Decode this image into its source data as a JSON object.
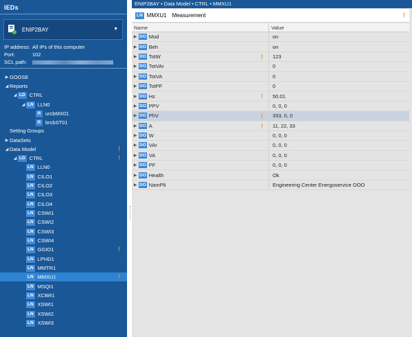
{
  "ieds_panel": {
    "title": "IEDs",
    "ied_name": "ENIP2BAY",
    "ip_label": "IP address:",
    "ip_value": "All IPs of this computer",
    "port_label": "Port:",
    "port_value": "102",
    "scl_label": "SCL path:"
  },
  "tree": [
    {
      "label": "GOOSE",
      "badge": "",
      "toggle": "▶",
      "warn": false
    },
    {
      "label": "Reports",
      "badge": "",
      "toggle": "◢",
      "warn": false
    },
    {
      "label": "CTRL",
      "badge": "LD",
      "toggle": "◢",
      "warn": false
    },
    {
      "label": "LLN0",
      "badge": "LN",
      "toggle": "◢",
      "warn": false
    },
    {
      "label": "urcbMX01",
      "badge": "R",
      "toggle": "",
      "warn": false
    },
    {
      "label": "brcbST01",
      "badge": "R",
      "toggle": "",
      "warn": false
    },
    {
      "label": "Setting Groups",
      "badge": "",
      "toggle": "",
      "warn": false
    },
    {
      "label": "DataSets",
      "badge": "",
      "toggle": "▶",
      "warn": false
    },
    {
      "label": "Data Model",
      "badge": "",
      "toggle": "◢",
      "warn": true
    },
    {
      "label": "CTRL",
      "badge": "LD",
      "toggle": "◢",
      "warn": true
    },
    {
      "label": "LLN0",
      "badge": "LN",
      "toggle": "",
      "warn": false
    },
    {
      "label": "CILO1",
      "badge": "LN",
      "toggle": "",
      "warn": false
    },
    {
      "label": "CILO2",
      "badge": "LN",
      "toggle": "",
      "warn": false
    },
    {
      "label": "CILO3",
      "badge": "LN",
      "toggle": "",
      "warn": false
    },
    {
      "label": "CILO4",
      "badge": "LN",
      "toggle": "",
      "warn": false
    },
    {
      "label": "CSWI1",
      "badge": "LN",
      "toggle": "",
      "warn": false
    },
    {
      "label": "CSWI2",
      "badge": "LN",
      "toggle": "",
      "warn": false
    },
    {
      "label": "CSWI3",
      "badge": "LN",
      "toggle": "",
      "warn": false
    },
    {
      "label": "CSWI4",
      "badge": "LN",
      "toggle": "",
      "warn": false
    },
    {
      "label": "GGIO1",
      "badge": "LN",
      "toggle": "",
      "warn": true
    },
    {
      "label": "LPHD1",
      "badge": "LN",
      "toggle": "",
      "warn": false
    },
    {
      "label": "MMTR1",
      "badge": "LN",
      "toggle": "",
      "warn": false
    },
    {
      "label": "MMXU1",
      "badge": "LN",
      "toggle": "",
      "warn": true,
      "selected": true
    },
    {
      "label": "MSQI1",
      "badge": "LN",
      "toggle": "",
      "warn": false
    },
    {
      "label": "XCBR1",
      "badge": "LN",
      "toggle": "",
      "warn": false
    },
    {
      "label": "XSWI1",
      "badge": "LN",
      "toggle": "",
      "warn": false
    },
    {
      "label": "XSWI2",
      "badge": "LN",
      "toggle": "",
      "warn": false
    },
    {
      "label": "XSWI3",
      "badge": "LN",
      "toggle": "",
      "warn": false
    }
  ],
  "breadcrumb": "ENIP2BAY • Data Model • CTRL • MMXU1",
  "node": {
    "badge": "LN",
    "name": "MMXU1",
    "description": "Measurement",
    "warn": "!"
  },
  "grid": {
    "col_name": "Name",
    "col_value": "Value",
    "rows": [
      {
        "name": "Mod",
        "value": "on",
        "warn": false
      },
      {
        "name": "Beh",
        "value": "on",
        "warn": false
      },
      {
        "name": "TotW",
        "value": "123",
        "warn": true
      },
      {
        "name": "TotVAr",
        "value": "0",
        "warn": false
      },
      {
        "name": "TotVA",
        "value": "0",
        "warn": false
      },
      {
        "name": "TotPF",
        "value": "0",
        "warn": false
      },
      {
        "name": "Hz",
        "value": "50.01",
        "warn": true
      },
      {
        "name": "PPV",
        "value": "0, 0, 0",
        "warn": false
      },
      {
        "name": "PhV",
        "value": "333, 0, 0",
        "warn": true,
        "highlight": true
      },
      {
        "name": "A",
        "value": "11, 22, 33",
        "warn": true
      },
      {
        "name": "W",
        "value": "0, 0, 0",
        "warn": false
      },
      {
        "name": "VAr",
        "value": "0, 0, 0",
        "warn": false
      },
      {
        "name": "VA",
        "value": "0, 0, 0",
        "warn": false
      },
      {
        "name": "PF",
        "value": "0, 0, 0",
        "warn": false
      },
      {
        "name": "Health",
        "value": "Ok",
        "warn": false
      },
      {
        "name": "NamPlt",
        "value": "Engineering Center Energoservice OOO",
        "warn": false
      }
    ],
    "row_badge": "DO",
    "warn_symbol": "!"
  },
  "colors": {
    "panel_blue": "#1a5796",
    "selected_blue": "#2d83d4",
    "warning_orange": "#f08a1c",
    "badge_blue": "#3c84d4"
  }
}
